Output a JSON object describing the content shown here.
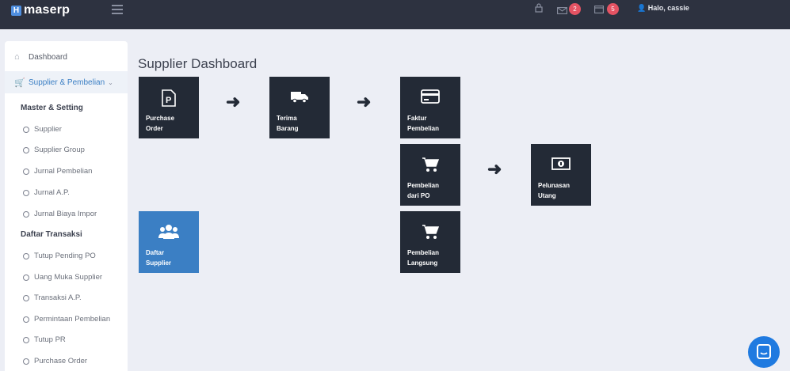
{
  "app": {
    "logo_letter": "H",
    "name": "maserp"
  },
  "topbar": {
    "icons": [
      "lock-icon",
      "mail-icon",
      "calendar-icon"
    ],
    "mail_badge": "2",
    "calendar_badge": "5",
    "user_greeting": "Halo, cassie"
  },
  "sidebar": {
    "dashboard": "Dashboard",
    "supplier_menu": "Supplier & Pembelian",
    "section1": "Master & Setting",
    "section1_items": [
      "Supplier",
      "Supplier Group",
      "Jurnal Pembelian",
      "Jurnal A.P.",
      "Jurnal Biaya Impor"
    ],
    "section2": "Daftar Transaksi",
    "section2_items": [
      "Tutup Pending PO",
      "Uang Muka Supplier",
      "Transaksi A.P.",
      "Permintaan Pembelian",
      "Tutup PR",
      "Purchase Order"
    ]
  },
  "main": {
    "title": "Supplier Dashboard",
    "tiles": {
      "purchase_order": [
        "Purchase",
        "Order"
      ],
      "terima_barang": [
        "Terima",
        "Barang"
      ],
      "faktur_pembelian": [
        "Faktur",
        "Pembelian"
      ],
      "pembelian_po": [
        "Pembelian",
        "dari PO"
      ],
      "pelunasan_utang": [
        "Pelunasan",
        "Utang"
      ],
      "pembelian_langsung": [
        "Pembelian",
        "Langsung"
      ],
      "daftar_supplier": [
        "Daftar",
        "Supplier"
      ]
    }
  },
  "colors": {
    "topbar": "#2d3240",
    "tile": "#232a36",
    "tile_highlight": "#3b7fc4",
    "accent": "#1f7ae0",
    "badge": "#e55363"
  }
}
